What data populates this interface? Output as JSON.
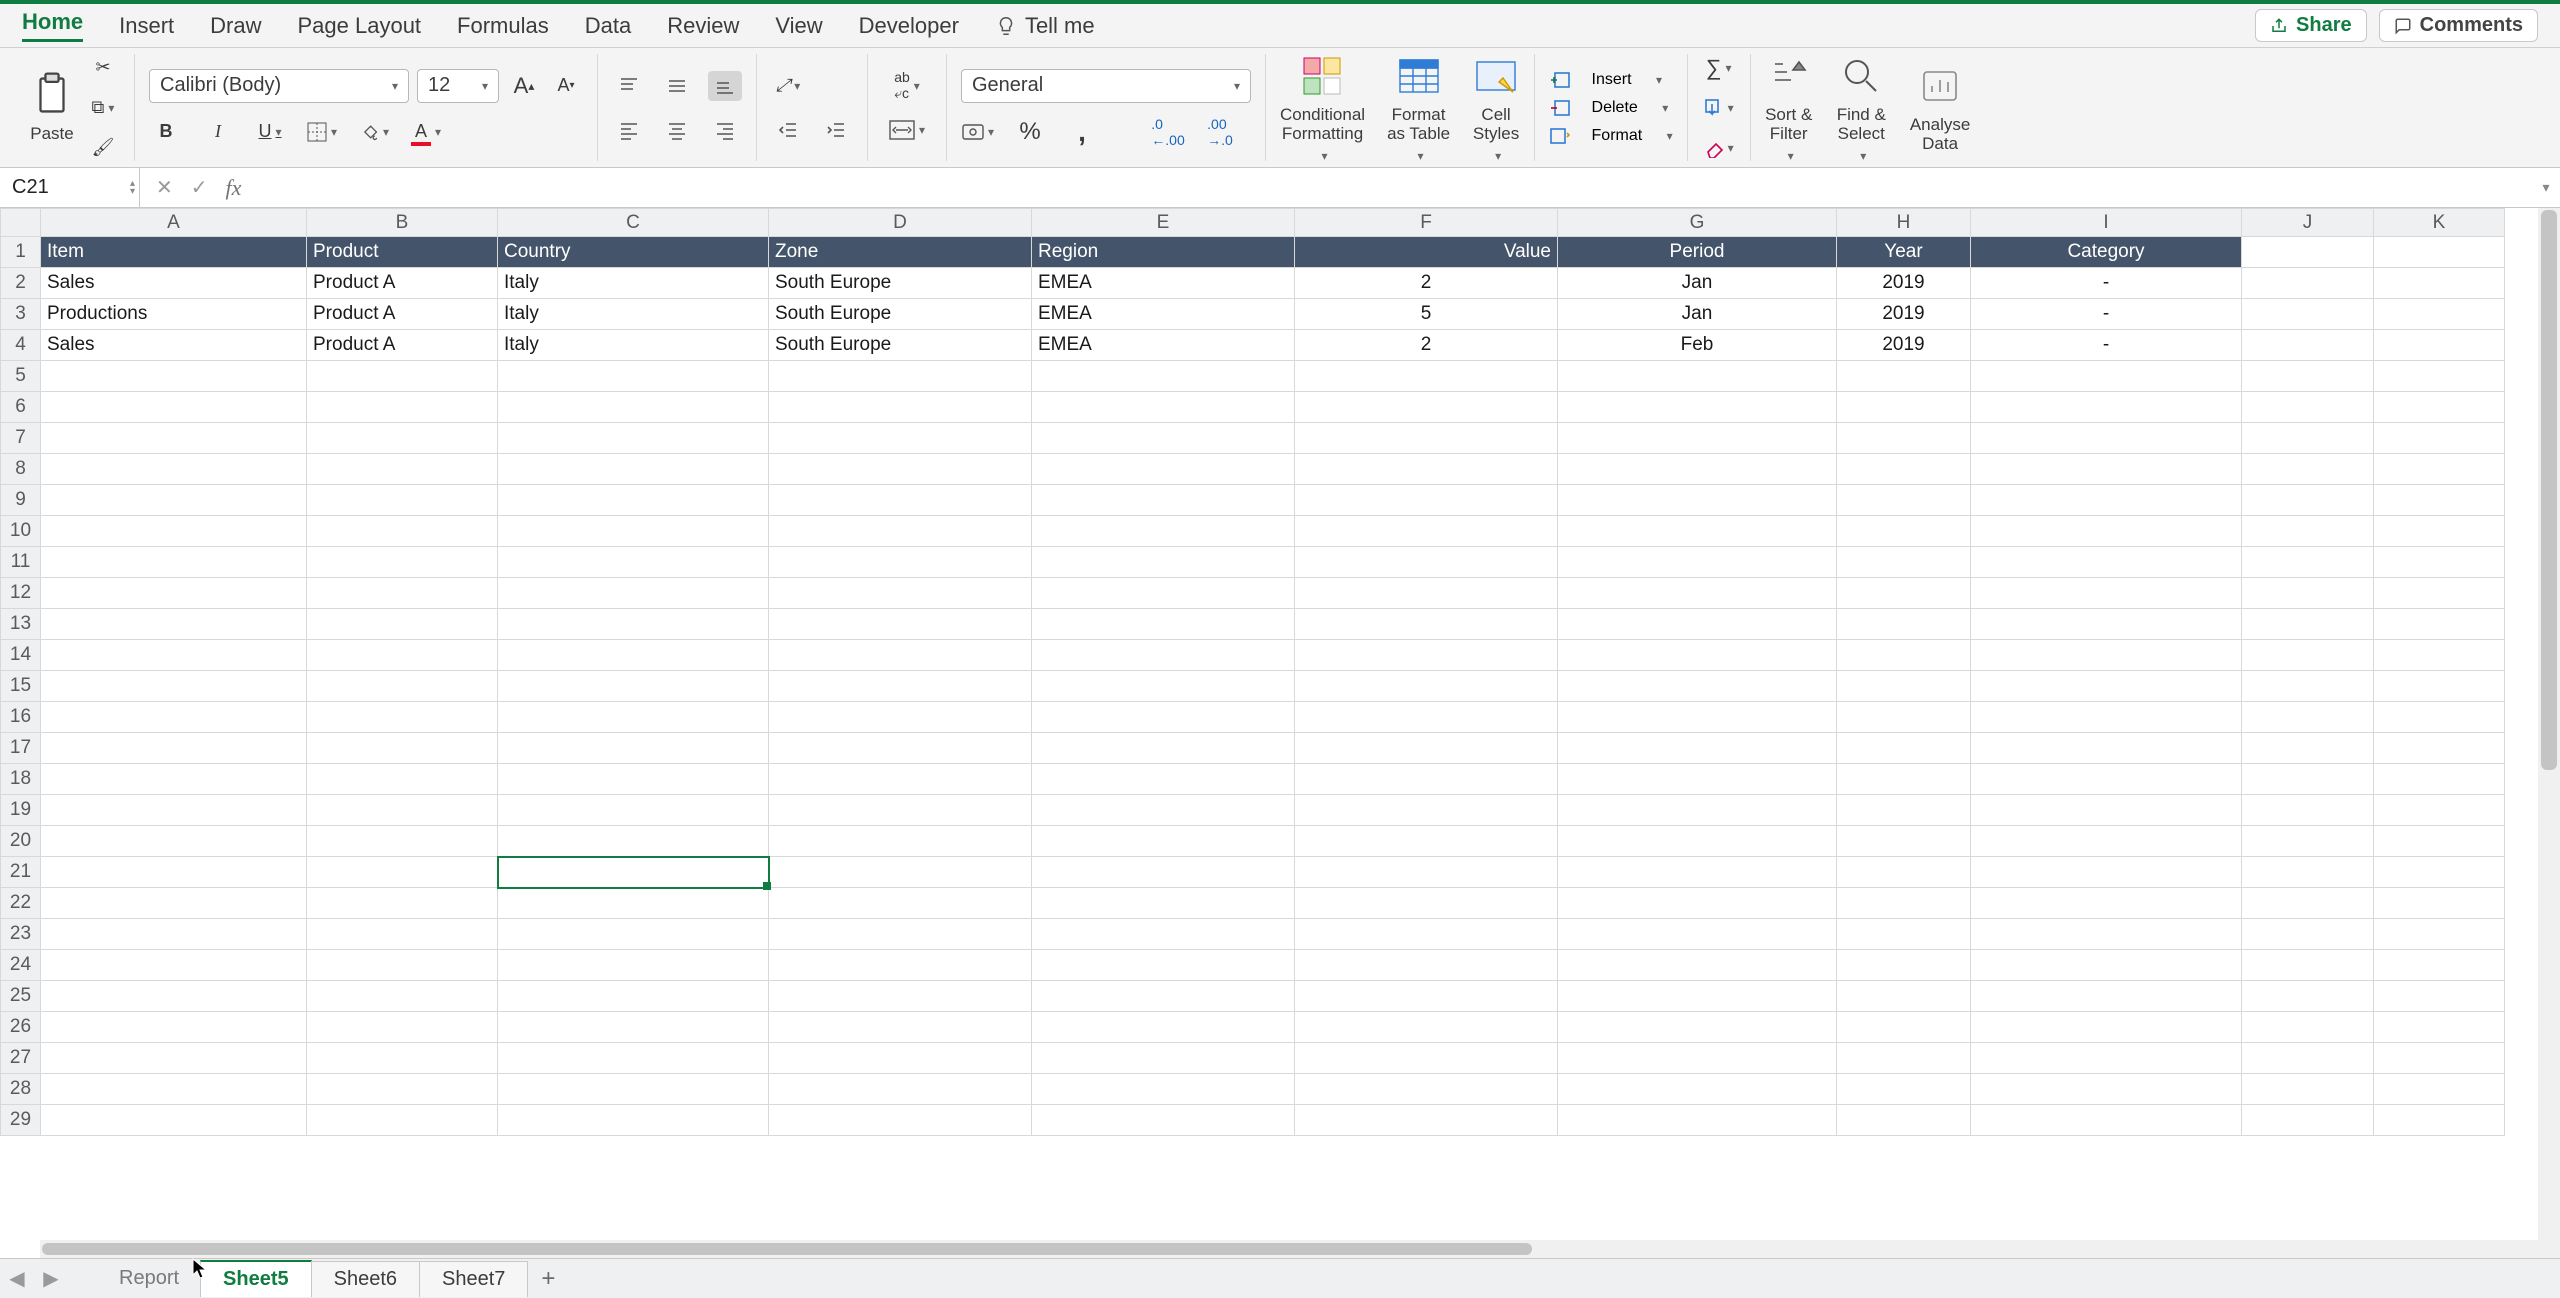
{
  "ribbon": {
    "tabs": [
      "Home",
      "Insert",
      "Draw",
      "Page Layout",
      "Formulas",
      "Data",
      "Review",
      "View",
      "Developer"
    ],
    "active_tab": "Home",
    "tell_me": "Tell me",
    "share": "Share",
    "comments": "Comments"
  },
  "home": {
    "paste": "Paste",
    "font_name": "Calibri (Body)",
    "font_size": "12",
    "number_format": "General",
    "cond_fmt": "Conditional\nFormatting",
    "fmt_table": "Format\nas Table",
    "cell_styles": "Cell\nStyles",
    "insert": "Insert",
    "delete": "Delete",
    "format": "Format",
    "sort_filter": "Sort &\nFilter",
    "find_select": "Find &\nSelect",
    "analyse": "Analyse\nData"
  },
  "formula_bar": {
    "cell_ref": "C21",
    "formula": ""
  },
  "columns": [
    "A",
    "B",
    "C",
    "D",
    "E",
    "F",
    "G",
    "H",
    "I",
    "J",
    "K"
  ],
  "headers": [
    "Item",
    "Product",
    "Country",
    "Zone",
    "Region",
    "Value",
    "Period",
    "Year",
    "Category"
  ],
  "rows": [
    {
      "n": 2,
      "Item": "Sales",
      "Product": "Product A",
      "Country": "Italy",
      "Zone": "South Europe",
      "Region": "EMEA",
      "Value": "2",
      "Period": "Jan",
      "Year": "2019",
      "Category": "-"
    },
    {
      "n": 3,
      "Item": "Productions",
      "Product": "Product A",
      "Country": "Italy",
      "Zone": "South Europe",
      "Region": "EMEA",
      "Value": "5",
      "Period": "Jan",
      "Year": "2019",
      "Category": "-"
    },
    {
      "n": 4,
      "Item": "Sales",
      "Product": "Product A",
      "Country": "Italy",
      "Zone": "South Europe",
      "Region": "EMEA",
      "Value": "2",
      "Period": "Feb",
      "Year": "2019",
      "Category": "-"
    }
  ],
  "empty_rows_start": 5,
  "empty_rows_end": 29,
  "selected_cell": {
    "col": "C",
    "row": 21
  },
  "sheet_tabs": [
    "Report",
    "Sheet5",
    "Sheet6",
    "Sheet7"
  ],
  "active_sheet": "Sheet5"
}
